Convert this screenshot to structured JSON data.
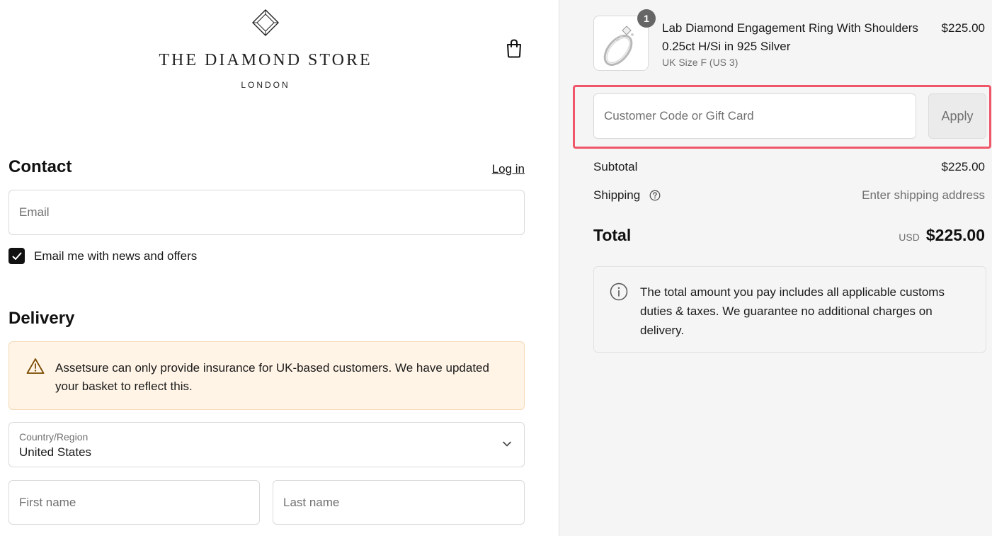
{
  "brand": {
    "name": "THE DIAMOND STORE",
    "subtitle": "LONDON"
  },
  "contact": {
    "title": "Contact",
    "login_link": "Log in",
    "email_placeholder": "Email",
    "newsletter_label": "Email me with news and offers",
    "newsletter_checked": true
  },
  "delivery": {
    "title": "Delivery",
    "notice": "Assetsure can only provide insurance for UK-based customers. We have updated your basket to reflect this.",
    "country_label": "Country/Region",
    "country_value": "United States",
    "first_name_placeholder": "First name",
    "last_name_placeholder": "Last name"
  },
  "order": {
    "item": {
      "quantity": "1",
      "name": "Lab Diamond Engagement Ring With Shoulders 0.25ct H/Si in 925 Silver",
      "variant": "UK Size F (US 3)",
      "price": "$225.00"
    },
    "discount_placeholder": "Customer Code or Gift Card",
    "apply_label": "Apply",
    "subtotal_label": "Subtotal",
    "subtotal_value": "$225.00",
    "shipping_label": "Shipping",
    "shipping_value": "Enter shipping address",
    "total_label": "Total",
    "total_currency": "USD",
    "total_value": "$225.00",
    "info_text": "The total amount you pay includes all applicable customs duties & taxes. We guarantee no additional charges on delivery."
  },
  "colors": {
    "highlight": "#f0566a",
    "notice_bg": "#fff4e6",
    "summary_bg": "#f5f5f5"
  },
  "icons": {
    "logo": "diamond-logo-icon",
    "bag": "shopping-bag-icon",
    "warning": "warning-icon",
    "chevron": "chevron-down-icon",
    "help": "help-circle-icon",
    "info": "info-icon"
  }
}
